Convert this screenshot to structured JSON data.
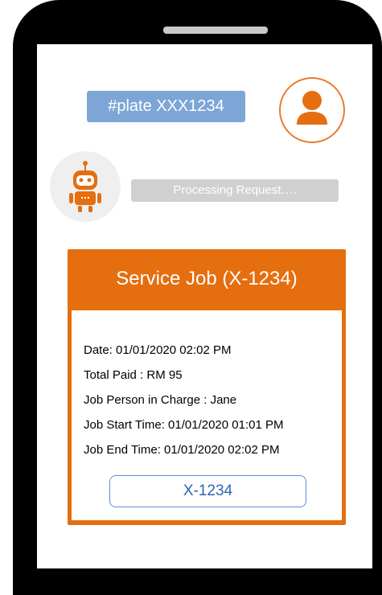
{
  "chat": {
    "user_message": "#plate XXX1234",
    "bot_message": "Processing Request….",
    "user_avatar_icon": "user-icon",
    "bot_avatar_icon": "robot-icon"
  },
  "service_job": {
    "title": "Service Job (X-1234)",
    "date": "Date: 01/01/2020  02:02 PM",
    "total_paid": "Total Paid : RM 95",
    "person_in_charge": "Job Person in Charge : Jane",
    "start_time": "Job Start Time: 01/01/2020 01:01 PM",
    "end_time": "Job End Time: 01/01/2020 02:02 PM",
    "job_id_label": "X-1234"
  },
  "colors": {
    "accent_orange": "#e56e0f",
    "user_bubble": "#7da5d6",
    "bot_bubble": "#d0d0d0",
    "button_text": "#2e64b0"
  }
}
